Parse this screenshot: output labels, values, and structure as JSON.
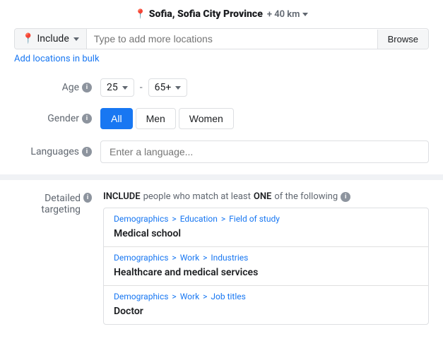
{
  "location": {
    "city": "Sofia, Sofia City Province",
    "distance": "+ 40 km"
  },
  "include": {
    "label": "Include",
    "placeholder": "Type to add more locations",
    "browse_label": "Browse",
    "add_bulk_label": "Add locations in bulk"
  },
  "age": {
    "label": "Age",
    "min": "25",
    "max": "65+",
    "dash": "-"
  },
  "gender": {
    "label": "Gender",
    "options": [
      "All",
      "Men",
      "Women"
    ],
    "active": "All"
  },
  "languages": {
    "label": "Languages",
    "placeholder": "Enter a language..."
  },
  "detailed_targeting": {
    "label": "Detailed targeting",
    "header_include": "INCLUDE",
    "header_middle": "people who match at least",
    "header_one": "ONE",
    "header_end": "of the following",
    "items": [
      {
        "breadcrumb": [
          "Demographics",
          "Education",
          "Field of study"
        ],
        "value": "Medical school"
      },
      {
        "breadcrumb": [
          "Demographics",
          "Work",
          "Industries"
        ],
        "value": "Healthcare and medical services"
      },
      {
        "breadcrumb": [
          "Demographics",
          "Work",
          "Job titles"
        ],
        "value": "Doctor"
      }
    ]
  },
  "icons": {
    "info": "i",
    "pin": "📍",
    "chevron": "▾"
  }
}
